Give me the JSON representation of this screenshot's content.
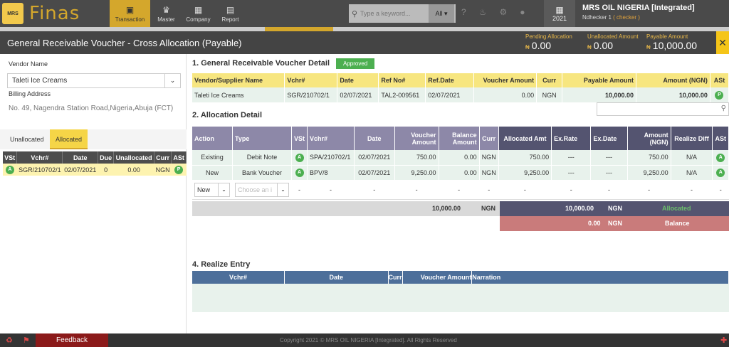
{
  "header": {
    "logo_text": "Finas",
    "logo_badge": "MRS",
    "nav": [
      {
        "label": "Transaction",
        "icon": "transaction-icon",
        "glyph": "▣"
      },
      {
        "label": "Master",
        "icon": "master-icon",
        "glyph": "♛"
      },
      {
        "label": "Company",
        "icon": "company-icon",
        "glyph": "▦"
      },
      {
        "label": "Report",
        "icon": "report-icon",
        "glyph": "▤"
      }
    ],
    "search_placeholder": "Type a keyword...",
    "search_filter": "All",
    "year": "2021",
    "company_name": "MRS OIL NIGERIA [Integrated]",
    "user": "Ndhecker 1",
    "user_role": "( checker )"
  },
  "titlebar": {
    "title": "General Receivable Voucher - Cross Allocation (Payable)",
    "pending_label": "Pending Allocation",
    "pending_currency": "₦",
    "pending_value": "0.00",
    "unallocated_label": "Unallocated Amount",
    "unallocated_currency": "₦",
    "unallocated_value": "0.00",
    "payable_label": "Payable Amount",
    "payable_currency": "₦",
    "payable_value": "10,000.00"
  },
  "left": {
    "vendor_label": "Vendor Name",
    "vendor_value": "Taleti Ice Creams",
    "billing_label": "Billing Address",
    "billing_address": "No. 49, Nagendra Station Road,Nigeria,Abuja (FCT)",
    "tabs": [
      "Unallocated",
      "Allocated"
    ],
    "table": {
      "headers": [
        "VSt",
        "Vchr#",
        "Date",
        "Due",
        "Unallocated",
        "Curr",
        "ASt"
      ],
      "rows": [
        {
          "vst": "A",
          "vchr": "SGR/210702/1",
          "date": "02/07/2021",
          "due": "0",
          "unallocated": "0.00",
          "curr": "NGN",
          "ast": "P"
        }
      ]
    }
  },
  "section1": {
    "title": "1. General Receivable Voucher Detail",
    "status": "Approved",
    "headers": [
      "Vendor/Supplier Name",
      "Vchr#",
      "Date",
      "Ref No#",
      "Ref.Date",
      "Voucher Amount",
      "Curr",
      "Payable Amount",
      "Amount (NGN)",
      "ASt"
    ],
    "row": {
      "vendor": "Taleti Ice Creams",
      "vchr": "SGR/210702/1",
      "date": "02/07/2021",
      "ref": "TAL2-009561",
      "refdate": "02/07/2021",
      "voucher_amount": "0.00",
      "curr": "NGN",
      "payable": "10,000.00",
      "amount": "10,000.00",
      "ast": "P"
    }
  },
  "section2": {
    "title": "2. Allocation Detail",
    "headers": [
      "Action",
      "Type",
      "VSt",
      "Vchr#",
      "Date",
      "Voucher Amount",
      "Balance Amount",
      "Curr",
      "Allocated Amt",
      "Ex.Rate",
      "Ex.Date",
      "Amount (NGN)",
      "Realize Diff",
      "ASt"
    ],
    "rows": [
      {
        "action": "Existing",
        "type": "Debit Note",
        "vst": "A",
        "vchr": "SPA/210702/1",
        "date": "02/07/2021",
        "voucher": "750.00",
        "balance": "0.00",
        "curr": "NGN",
        "allocated": "750.00",
        "exrate": "---",
        "exdate": "---",
        "amount": "750.00",
        "realize": "N/A",
        "ast": "A"
      },
      {
        "action": "New",
        "type": "Bank Voucher",
        "vst": "A",
        "vchr": "BPV/8",
        "date": "02/07/2021",
        "voucher": "9,250.00",
        "balance": "0.00",
        "curr": "NGN",
        "allocated": "9,250.00",
        "exrate": "---",
        "exdate": "---",
        "amount": "9,250.00",
        "realize": "N/A",
        "ast": "A"
      }
    ],
    "edit_row": {
      "action_value": "New",
      "type_placeholder": "Choose an i",
      "dash": "-"
    },
    "total": {
      "amount": "10,000.00",
      "curr": "NGN"
    },
    "allocated": {
      "amount": "10,000.00",
      "curr": "NGN",
      "label": "Allocated"
    },
    "balance": {
      "amount": "0.00",
      "curr": "NGN",
      "label": "Balance"
    }
  },
  "section4": {
    "title": "4. Realize Entry",
    "headers": [
      "Vchr#",
      "Date",
      "Curr",
      "Voucher Amount",
      "Narration"
    ]
  },
  "footer": {
    "feedback": "Feedback",
    "copyright": "Copyright 2021 © MRS OIL NIGERIA [Integrated]. All Rights Reserved"
  }
}
